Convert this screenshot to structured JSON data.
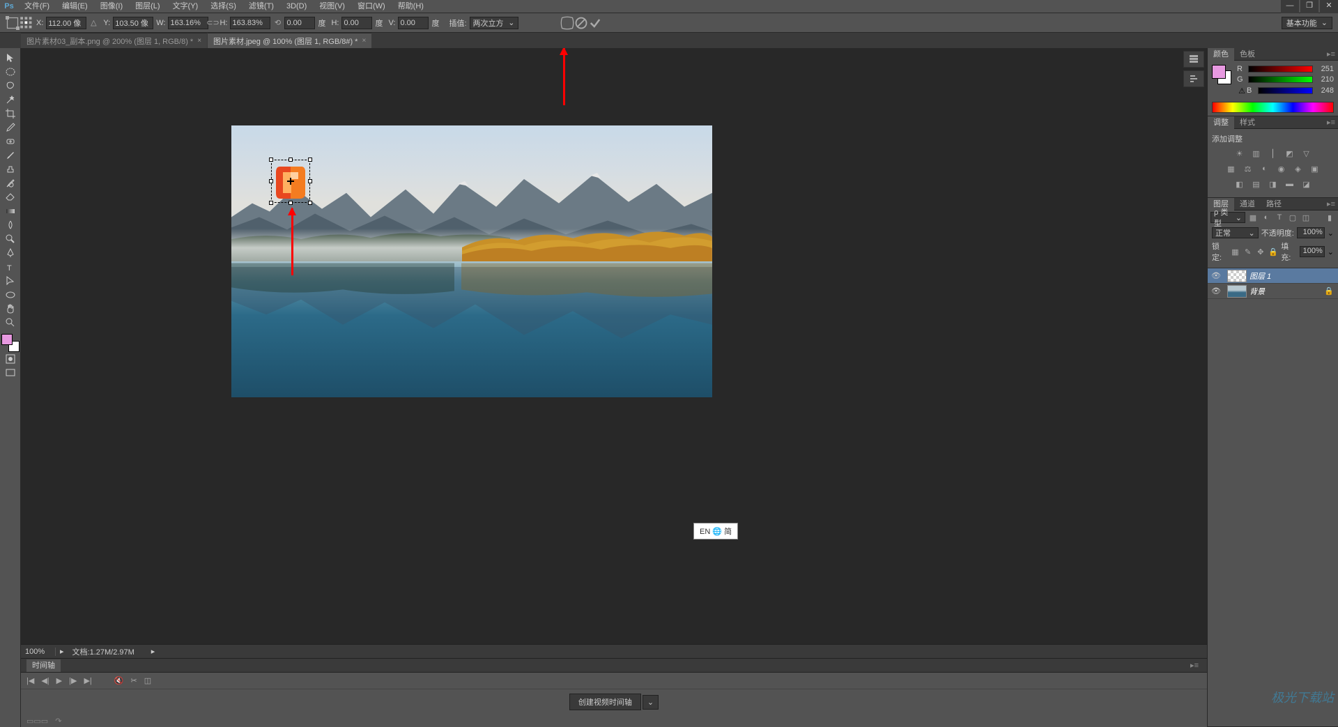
{
  "menubar": {
    "items": [
      "文件(F)",
      "编辑(E)",
      "图像(I)",
      "图层(L)",
      "文字(Y)",
      "选择(S)",
      "滤镜(T)",
      "3D(D)",
      "视图(V)",
      "窗口(W)",
      "帮助(H)"
    ]
  },
  "options": {
    "x_label": "X:",
    "x": "112.00 像",
    "y_label": "Y:",
    "y": "103.50 像",
    "w_label": "W:",
    "w": "163.16%",
    "h_label": "H:",
    "h": "163.83%",
    "rot_label": "旋",
    "rot": "0.00",
    "rot_unit": "度",
    "hskew_label": "H:",
    "hskew": "0.00",
    "hskew_unit": "度",
    "vskew_label": "V:",
    "vskew": "0.00",
    "vskew_unit": "度",
    "interp_label": "插值:",
    "interp": "两次立方",
    "workspace": "基本功能"
  },
  "tabs": [
    {
      "title": "图片素材03_副本.png @ 200% (图层 1, RGB/8) *",
      "active": false
    },
    {
      "title": "图片素材.jpeg @ 100% (图层 1, RGB/8#) *",
      "active": true
    }
  ],
  "status": {
    "zoom": "100%",
    "doc_info": "文档:1.27M/2.97M",
    "ime": "EN 🌐 简"
  },
  "timeline": {
    "tab": "时间轴",
    "create_btn": "创建视频时间轴"
  },
  "color_panel": {
    "tabs": [
      "颜色",
      "色板"
    ],
    "fg": "#e799e0",
    "r_label": "R",
    "r": "251",
    "g_label": "G",
    "g": "210",
    "b_label": "B",
    "b": "248"
  },
  "adjust_panel": {
    "tabs": [
      "调整",
      "样式"
    ],
    "label": "添加调整"
  },
  "layers_panel": {
    "tabs": [
      "图层",
      "通道",
      "路径"
    ],
    "filter_label": "ρ 类型",
    "blend_mode": "正常",
    "opacity_label": "不透明度:",
    "opacity": "100%",
    "lock_label": "锁定:",
    "fill_label": "填充:",
    "fill": "100%",
    "layers": [
      {
        "name": "图层 1",
        "selected": true,
        "locked": false,
        "thumb": "checker"
      },
      {
        "name": "背景",
        "selected": false,
        "locked": true,
        "thumb": "image"
      }
    ]
  },
  "watermark": "极光下载站"
}
